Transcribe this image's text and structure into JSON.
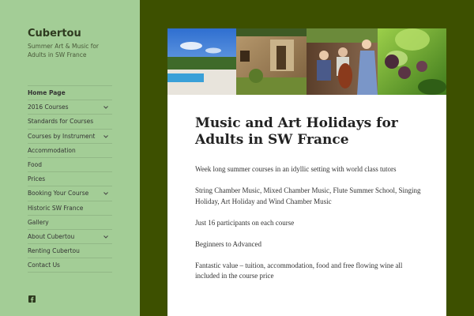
{
  "site": {
    "title": "Cubertou",
    "description": "Summer Art & Music for Adults in SW France"
  },
  "nav": [
    {
      "label": "Home Page",
      "current": true,
      "has_submenu": false
    },
    {
      "label": "2016 Courses",
      "has_submenu": true
    },
    {
      "label": "Standards for Courses",
      "has_submenu": false
    },
    {
      "label": "Courses by Instrument",
      "has_submenu": true
    },
    {
      "label": "Accommodation",
      "has_submenu": false
    },
    {
      "label": "Food",
      "has_submenu": false
    },
    {
      "label": "Prices",
      "has_submenu": false
    },
    {
      "label": "Booking Your Course",
      "has_submenu": true
    },
    {
      "label": "Historic SW France",
      "has_submenu": false
    },
    {
      "label": "Gallery",
      "has_submenu": false
    },
    {
      "label": "About Cubertou",
      "has_submenu": true
    },
    {
      "label": "Renting Cubertou",
      "has_submenu": false
    },
    {
      "label": "Contact Us",
      "has_submenu": false
    }
  ],
  "social": {
    "icon": "facebook-icon"
  },
  "post": {
    "title": "Music and Art Holidays for Adults in SW France",
    "paragraphs": [
      "Week long summer courses in an idyllic setting with world class tutors",
      "String Chamber Music, Mixed Chamber Music, Flute Summer School, Singing Holiday, Art Holiday and Wind Chamber Music",
      "Just 16 participants on each course",
      "Beginners to Advanced",
      "Fantastic value –  tuition, accommodation, food and free flowing wine all included in the course price"
    ]
  },
  "colors": {
    "page_background": "#3d5000",
    "sidebar_background": "#a3cd96",
    "content_background": "#ffffff"
  }
}
